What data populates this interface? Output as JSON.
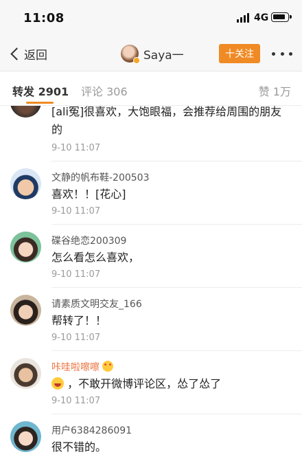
{
  "status_bar": {
    "time": "11:08",
    "network": "4G"
  },
  "nav": {
    "back_label": "返回",
    "user_name": "Saya一",
    "follow_label": "十关注"
  },
  "tabs": {
    "forward": "转发 2901",
    "comment": "评论 306",
    "like": "赞 1万"
  },
  "comments": [
    {
      "text": "[ali冤]很喜欢，大饱眼福，会推荐给周围的朋友的",
      "time": "9-10 11:07"
    },
    {
      "name": "文静的帆布鞋-200503",
      "text": "喜欢！！[花心]",
      "time": "9-10 11:07"
    },
    {
      "name": "碟谷绝恋200309",
      "text": "怎么看怎么喜欢，",
      "time": "9-10 11:07"
    },
    {
      "name": "请素质文明交友_166",
      "text": "帮转了！！",
      "time": "9-10 11:07"
    },
    {
      "name": "咔哇啦嚓嚓",
      "text": "，不敢开微博评论区，怂了怂了",
      "time": "9-10 11:07"
    },
    {
      "name": "用户6384286091",
      "text": "很不错的。"
    }
  ]
}
